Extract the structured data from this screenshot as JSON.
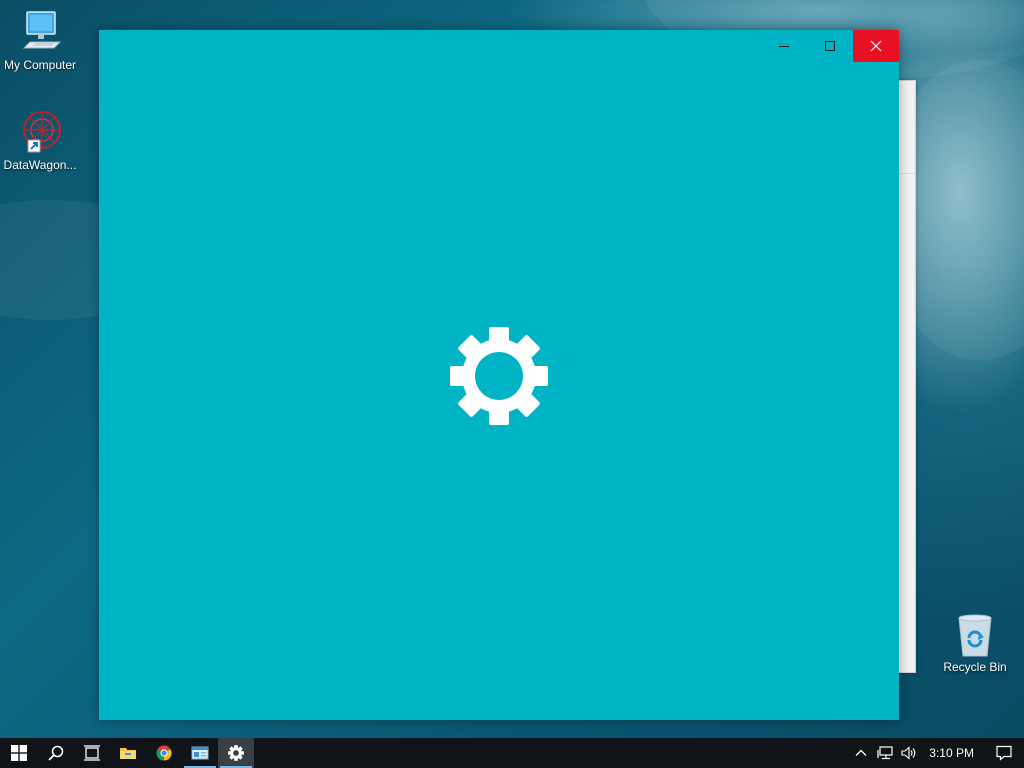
{
  "desktop": {
    "icons": [
      {
        "label": "My Computer",
        "icon": "computer-icon"
      },
      {
        "label": "DataWagon...",
        "icon": "datawagon-icon"
      },
      {
        "label": "Recycle Bin",
        "icon": "recycle-bin-icon"
      }
    ]
  },
  "window": {
    "state": "loading",
    "splash_icon": "gear-icon",
    "background_color": "#00b4c6",
    "buttons": {
      "minimize": "minimize-icon",
      "maximize": "maximize-icon",
      "close": "close-icon"
    }
  },
  "taskbar": {
    "items": [
      {
        "icon": "windows-start-icon",
        "running": false
      },
      {
        "icon": "search-icon",
        "running": false
      },
      {
        "icon": "task-view-icon",
        "running": false
      },
      {
        "icon": "file-explorer-icon",
        "running": false
      },
      {
        "icon": "chrome-icon",
        "running": false
      },
      {
        "icon": "app-window-icon",
        "running": true
      },
      {
        "icon": "settings-gear-icon",
        "running": true,
        "active": true
      }
    ],
    "tray": {
      "icons": [
        "chevron-up-icon",
        "network-icon",
        "volume-icon"
      ],
      "time": "3:10 PM",
      "notification_icon": "action-center-icon"
    }
  },
  "colors": {
    "accent": "#00b4c6",
    "close_button": "#e81123",
    "taskbar": "#101418",
    "running_indicator": "#76b9ed"
  }
}
